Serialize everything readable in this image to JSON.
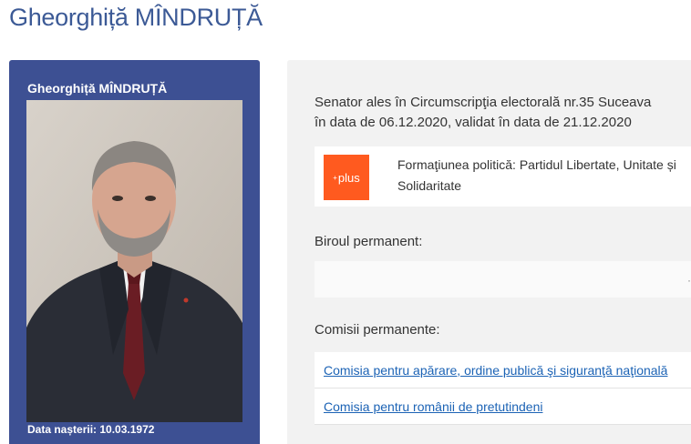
{
  "page": {
    "title": "Gheorghiță MÎNDRUȚĂ"
  },
  "profile": {
    "name": "Gheorghiță MÎNDRUȚĂ",
    "birth_label": "Data nașterii: 10.03.1972"
  },
  "info": {
    "senator_line1": "Senator ales în Circumscripţia electorală nr.35 Suceava",
    "senator_line2": "în data de 06.12.2020, validat în data de 21.12.2020",
    "party_logo_text": "plus",
    "party_label": "Formaţiunea politică: Partidul Libertate, Unitate și Solidaritate",
    "biroul_label": "Biroul permanent:",
    "comisii_label": "Comisii permanente:",
    "committees": [
      {
        "label": "Comisia pentru apărare, ordine publică şi siguranţă naţională"
      },
      {
        "label": "Comisia pentru românii de pretutindeni"
      }
    ]
  },
  "colors": {
    "title": "#3c5a96",
    "card_bg": "#3d5093",
    "party_logo": "#ff5a1f",
    "link": "#1c63b5"
  }
}
